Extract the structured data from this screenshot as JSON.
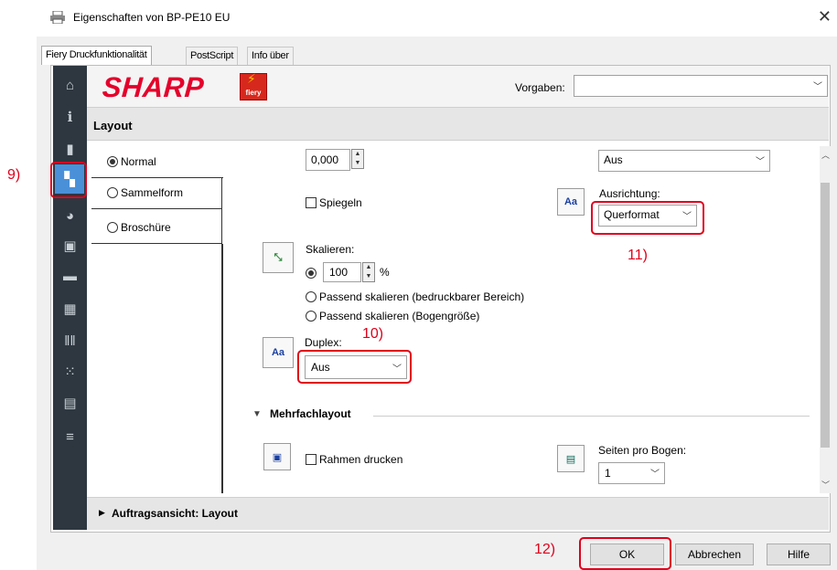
{
  "window": {
    "title": "Eigenschaften von BP-PE10 EU",
    "close": "✕"
  },
  "tabs": [
    {
      "label": "Fiery Druckfunktionalität",
      "active": true
    },
    {
      "label": "PostScript",
      "active": false
    },
    {
      "label": "Info über",
      "active": false
    }
  ],
  "sidebar": [
    {
      "icon": "home-icon",
      "glyph": "⌂"
    },
    {
      "icon": "info-icon",
      "glyph": "ℹ"
    },
    {
      "icon": "document-icon",
      "glyph": "▮"
    },
    {
      "icon": "layout-icon",
      "glyph": "▚",
      "selected": true
    },
    {
      "icon": "color-palette-icon",
      "glyph": "◕"
    },
    {
      "icon": "image-icon",
      "glyph": "▣"
    },
    {
      "icon": "book-icon",
      "glyph": "▬"
    },
    {
      "icon": "stamp-icon",
      "glyph": "▦"
    },
    {
      "icon": "barcode-icon",
      "glyph": "‖‖"
    },
    {
      "icon": "grid-icon",
      "glyph": "⁙"
    },
    {
      "icon": "printer-icon",
      "glyph": "▤"
    },
    {
      "icon": "settings-sliders-icon",
      "glyph": "≡"
    }
  ],
  "brand": {
    "logo_text": "SHARP",
    "fiery_text": "fiery"
  },
  "presets": {
    "label": "Vorgaben:",
    "value": ""
  },
  "section": {
    "title": "Layout"
  },
  "layout_modes": [
    {
      "label": "Normal",
      "selected": true
    },
    {
      "label": "Sammelform",
      "selected": false
    },
    {
      "label": "Broschüre",
      "selected": false
    }
  ],
  "offset": {
    "value": "0,000"
  },
  "aus_top": {
    "value": "Aus"
  },
  "mirror": {
    "label": "Spiegeln",
    "checked": false
  },
  "orientation": {
    "label": "Ausrichtung:",
    "value": "Querformat"
  },
  "scale": {
    "label": "Skalieren:",
    "value": "100",
    "unit": "%",
    "options": [
      "Passend skalieren (bedruckbarer Bereich)",
      "Passend skalieren (Bogengröße)"
    ]
  },
  "duplex": {
    "label": "Duplex:",
    "value": "Aus"
  },
  "multi_layout": {
    "title": "Mehrfachlayout",
    "frame_label": "Rahmen drucken",
    "pages_label": "Seiten pro Bogen:",
    "pages_value": "1"
  },
  "job_view": {
    "title": "Auftragsansicht: Layout"
  },
  "buttons": {
    "ok": "OK",
    "cancel": "Abbrechen",
    "help": "Hilfe"
  },
  "annotations": {
    "n9": "9)",
    "n10": "10)",
    "n11": "11)",
    "n12": "12)"
  },
  "colors": {
    "accent_red": "#e0001b",
    "sidebar_bg": "#2e3740",
    "sharp_red": "#e4002b"
  }
}
